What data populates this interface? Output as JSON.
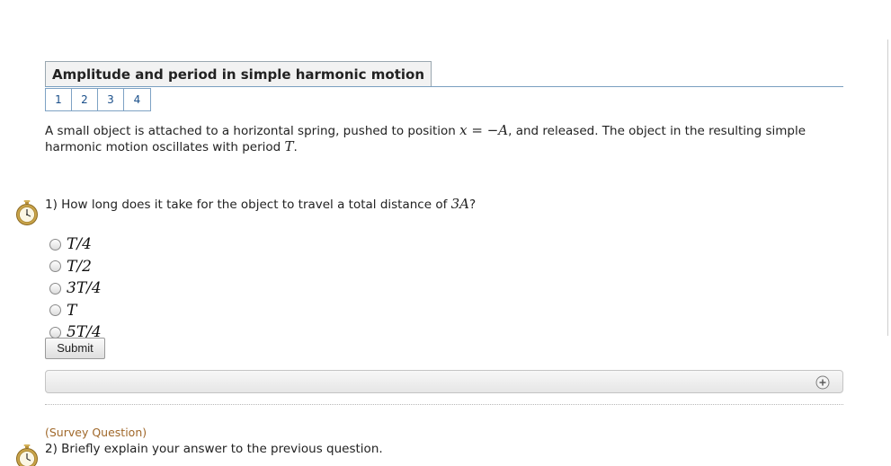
{
  "title": "Amplitude and period in simple harmonic motion",
  "part_tabs": [
    "1",
    "2",
    "3",
    "4"
  ],
  "intro": {
    "text_before": "A small object is attached to a horizontal spring, pushed to position ",
    "math_position": "x = −A",
    "text_middle": ", and released. The object in the resulting simple harmonic motion oscillates with period ",
    "math_period": "T",
    "text_end": "."
  },
  "question1": {
    "prefix": "1) How long does it take for the object to travel a total distance of ",
    "math": "3A",
    "suffix": "?"
  },
  "choices": [
    "T/4",
    "T/2",
    "3T/4",
    "T",
    "5T/4"
  ],
  "submit_label": "Submit",
  "survey_label": "(Survey Question)",
  "question2": "2) Briefly explain your answer to the previous question.",
  "icons": {
    "timer": "stopwatch-icon",
    "expand": "plus-circle-icon"
  },
  "colors": {
    "tab_border": "#7ea2c4",
    "tab_text": "#1a4f8a",
    "survey_label": "#a0682a",
    "stopwatch_gold": "#c9a44a"
  }
}
